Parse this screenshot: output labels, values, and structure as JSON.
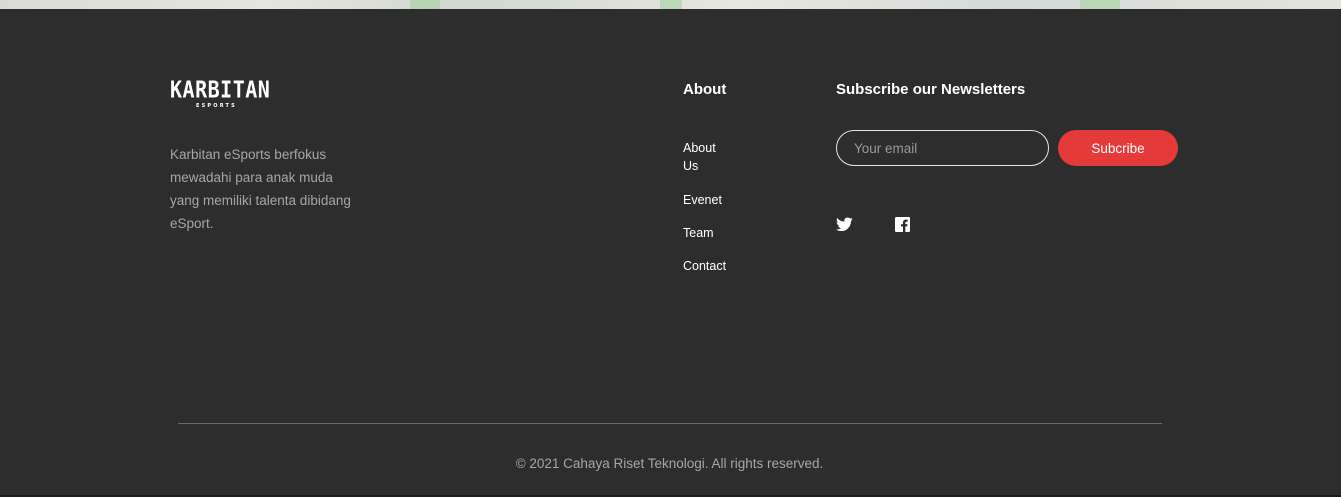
{
  "brand": {
    "logo_main": "KARBITAN",
    "logo_sub": "ESPORTS",
    "description": "Karbitan eSports berfokus mewadahi para anak muda yang memiliki talenta dibidang eSport."
  },
  "about": {
    "title": "About",
    "links": [
      "About Us",
      "Evenet",
      "Team",
      "Contact"
    ]
  },
  "newsletter": {
    "title": "Subscribe our Newsletters",
    "email_placeholder": "Your email",
    "email_value": "",
    "subscribe_label": "Subcribe"
  },
  "social": {
    "icons": [
      "twitter-icon",
      "facebook-icon"
    ]
  },
  "footer": {
    "copyright": "© 2021 Cahaya Riset Teknologi. All rights reserved."
  },
  "colors": {
    "background": "#2d2d2d",
    "accent": "#e53a3a",
    "muted_text": "#a6a6a6"
  }
}
